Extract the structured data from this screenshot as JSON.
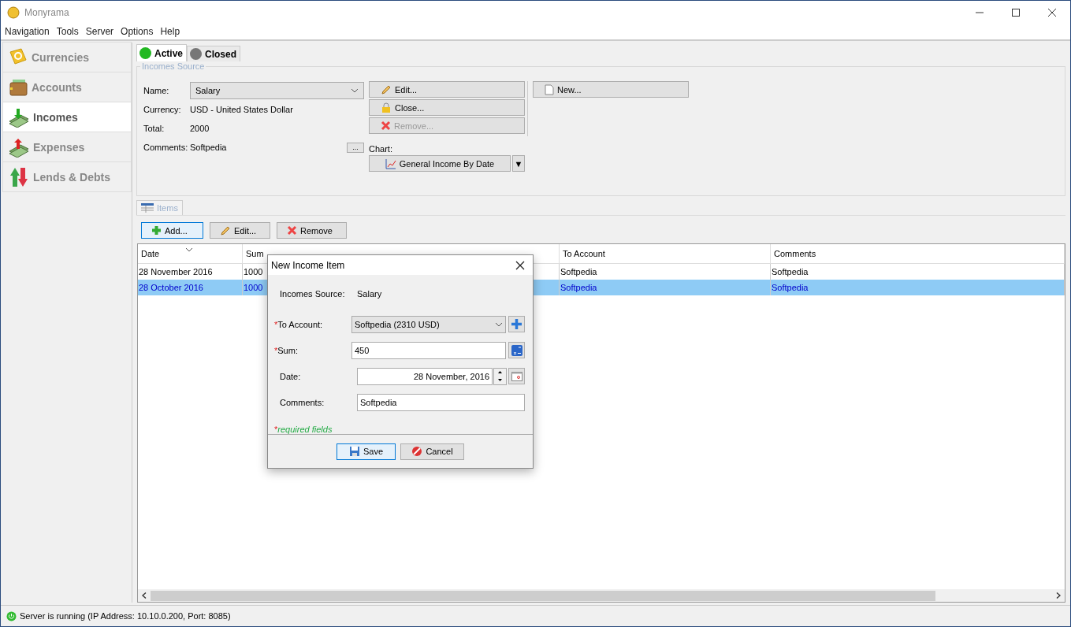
{
  "window": {
    "title": "Monyrama"
  },
  "menu": [
    "Navigation",
    "Tools",
    "Server",
    "Options",
    "Help"
  ],
  "sidebar": {
    "items": [
      {
        "label": "Currencies",
        "kind": "currencies",
        "selected": false
      },
      {
        "label": "Accounts",
        "kind": "accounts",
        "selected": false
      },
      {
        "label": "Incomes",
        "kind": "incomes",
        "selected": true
      },
      {
        "label": "Expenses",
        "kind": "expenses",
        "selected": false
      },
      {
        "label": "Lends & Debts",
        "kind": "lends",
        "selected": false
      }
    ]
  },
  "tabs": [
    {
      "label": "Active",
      "color": "#22b822",
      "selected": true
    },
    {
      "label": "Closed",
      "color": "#777777",
      "selected": false
    }
  ],
  "source": {
    "title": "Incomes Source",
    "name_label": "Name:",
    "name_value": "Salary",
    "fields": [
      {
        "label": "Currency:",
        "value": "USD - United States Dollar"
      },
      {
        "label": "Total:",
        "value": "2000"
      },
      {
        "label": "Comments:",
        "value": "Softpedia"
      }
    ],
    "more_button": "...",
    "buttons": [
      {
        "label": "Edit...",
        "kind": "edit",
        "disabled": false
      },
      {
        "label": "Close...",
        "kind": "lock",
        "disabled": false
      },
      {
        "label": "Remove...",
        "kind": "remove",
        "disabled": true
      }
    ],
    "new_button": "New...",
    "chart_label": "Chart:",
    "chart_value": "General Income By Date",
    "chart_arrow": "▼"
  },
  "items": {
    "tab": "Items",
    "buttons": [
      {
        "label": "Add...",
        "kind": "add",
        "selected": true
      },
      {
        "label": "Edit...",
        "kind": "edit",
        "selected": false
      },
      {
        "label": "Remove",
        "kind": "remove",
        "selected": false
      }
    ],
    "columns": [
      "Date",
      "Sum",
      "To Account",
      "Comments"
    ],
    "rows": [
      {
        "cells": [
          "28 November 2016",
          "1000",
          "Softpedia",
          "Softpedia"
        ],
        "selected": false
      },
      {
        "cells": [
          "28 October 2016",
          "1000",
          "Softpedia",
          "Softpedia"
        ],
        "selected": true
      }
    ]
  },
  "dialog": {
    "title": "New Income Item",
    "source_label": "Incomes Source:",
    "source_value": "Salary",
    "fields": [
      {
        "kind": "combo",
        "mark": "*",
        "label": "To Account:",
        "value": "Softpedia (2310 USD)"
      },
      {
        "kind": "text",
        "mark": "*",
        "label": "Sum:",
        "value": "450"
      },
      {
        "kind": "date",
        "label": "Date:",
        "value": "28 November, 2016"
      },
      {
        "kind": "plain",
        "label": "Comments:",
        "value": "Softpedia"
      }
    ],
    "note_mark": "*",
    "note": "required fields",
    "buttons": [
      {
        "label": "Save",
        "kind": "save",
        "selected": true
      },
      {
        "label": "Cancel",
        "kind": "cancel",
        "selected": false
      }
    ]
  },
  "status_bar": "Server is running (IP Address: 10.10.0.200, Port: 8085)"
}
